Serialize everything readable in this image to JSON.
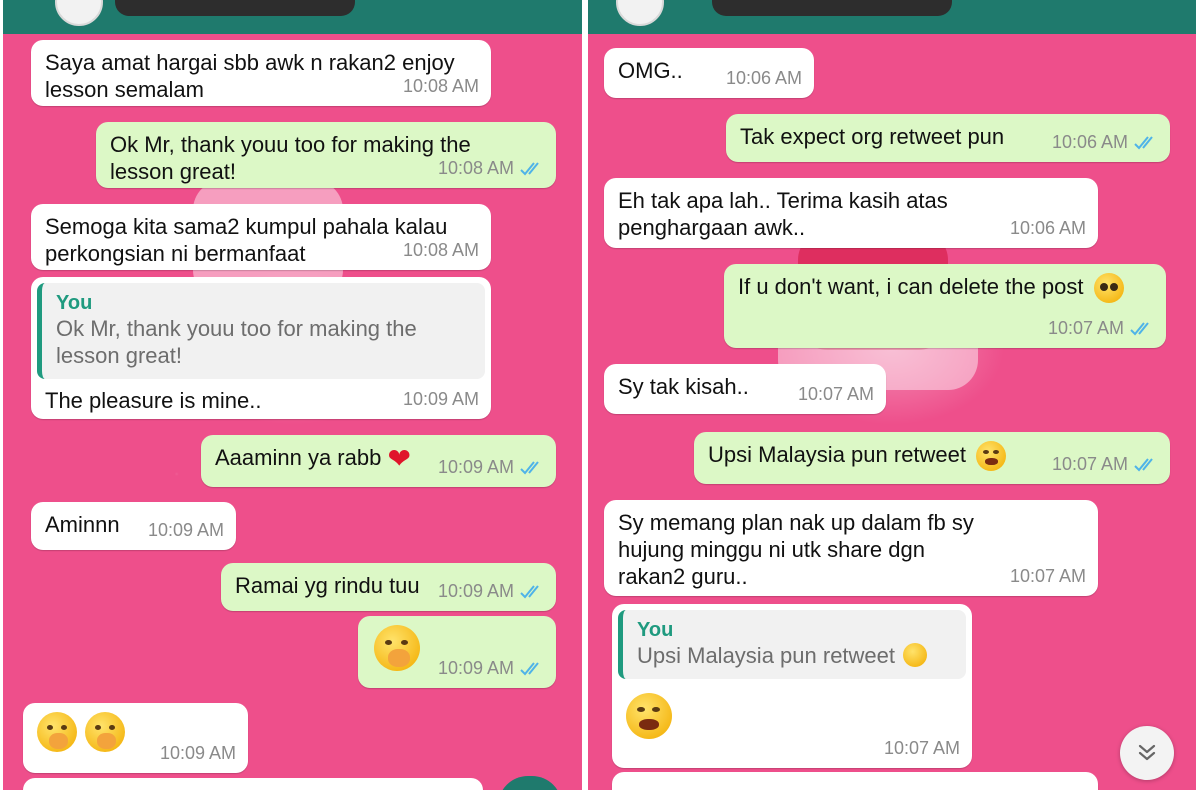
{
  "left_panel": {
    "messages": [
      {
        "direction": "in",
        "text": "Saya amat hargai sbb awk n rakan2 enjoy lesson semalam",
        "time": "10:08 AM"
      },
      {
        "direction": "out",
        "text": "Ok Mr, thank youu too for making the lesson great!",
        "time": "10:08 AM",
        "status": "read"
      },
      {
        "direction": "in",
        "text": "Semoga kita sama2 kumpul pahala kalau perkongsian ni bermanfaat",
        "time": "10:08 AM"
      },
      {
        "direction": "in",
        "reply_to": {
          "author": "You",
          "text": "Ok Mr, thank youu too for making the lesson great!"
        },
        "text": "The pleasure is mine..",
        "time": "10:09 AM"
      },
      {
        "direction": "out",
        "text": "Aaaminn ya rabb",
        "emoji": "red-heart",
        "time": "10:09 AM",
        "status": "read"
      },
      {
        "direction": "in",
        "text": "Aminnn",
        "time": "10:09 AM"
      },
      {
        "direction": "out",
        "text": "Ramai yg rindu tuu",
        "time": "10:09 AM",
        "status": "read"
      },
      {
        "direction": "out",
        "text": "",
        "emoji": "hand-over-mouth",
        "time": "10:09 AM",
        "status": "read"
      },
      {
        "direction": "in",
        "text": "",
        "emoji": "hand-over-mouth x2",
        "time": "10:09 AM"
      }
    ]
  },
  "right_panel": {
    "messages": [
      {
        "direction": "in",
        "text": "OMG..",
        "time": "10:06 AM"
      },
      {
        "direction": "out",
        "text": "Tak expect org retweet pun",
        "time": "10:06 AM",
        "status": "read"
      },
      {
        "direction": "in",
        "text": "Eh tak apa lah.. Terima kasih atas penghargaan awk..",
        "time": "10:06 AM"
      },
      {
        "direction": "out",
        "text": "If u don't want, i can delete the post",
        "emoji": "pleading-face",
        "time": "10:07 AM",
        "status": "read"
      },
      {
        "direction": "in",
        "text": "Sy tak kisah..",
        "time": "10:07 AM"
      },
      {
        "direction": "out",
        "text": "Upsi Malaysia pun retweet",
        "emoji": "rolling-laughing",
        "time": "10:07 AM",
        "status": "read"
      },
      {
        "direction": "in",
        "text": "Sy memang plan nak up dalam fb sy hujung minggu ni utk share dgn rakan2 guru..",
        "time": "10:07 AM"
      },
      {
        "direction": "in",
        "reply_to": {
          "author": "You",
          "text": "Upsi Malaysia pun retweet"
        },
        "text": "",
        "emoji": "rolling-laughing",
        "time": "10:07 AM"
      }
    ],
    "scroll_button_icon": "double-chevron-down-icon"
  },
  "colors": {
    "wallpaper": "#ee4f8b",
    "header": "#1f7a6d",
    "outgoing_bubble": "#dcf8c6",
    "incoming_bubble": "#ffffff",
    "read_ticks": "#4fb3e8",
    "quote_accent": "#1f9a7f"
  }
}
